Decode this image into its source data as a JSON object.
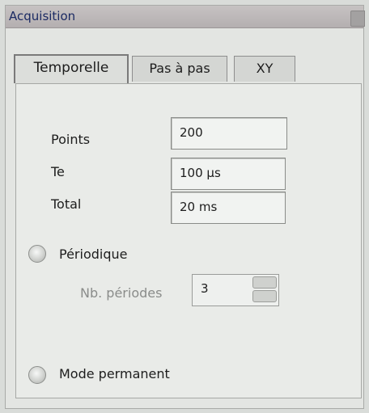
{
  "window": {
    "title": "Acquisition"
  },
  "tabs": [
    {
      "label": "Temporelle",
      "active": true
    },
    {
      "label": "Pas à pas",
      "active": false
    },
    {
      "label": "XY",
      "active": false
    }
  ],
  "fields": {
    "points": {
      "label": "Points",
      "value": "200"
    },
    "te": {
      "label": "Te",
      "value": "100 µs"
    },
    "total": {
      "label": "Total",
      "value": "20 ms"
    }
  },
  "periodique": {
    "label": "Périodique",
    "selected": false,
    "nb_periodes": {
      "label": "Nb. périodes",
      "value": "3"
    }
  },
  "mode_permanent": {
    "label": "Mode permanent",
    "selected": false
  },
  "colors": {
    "title_text": "#1b2a63",
    "panel_bg": "#e3e5e2",
    "disabled_text": "#8a8c8a"
  }
}
